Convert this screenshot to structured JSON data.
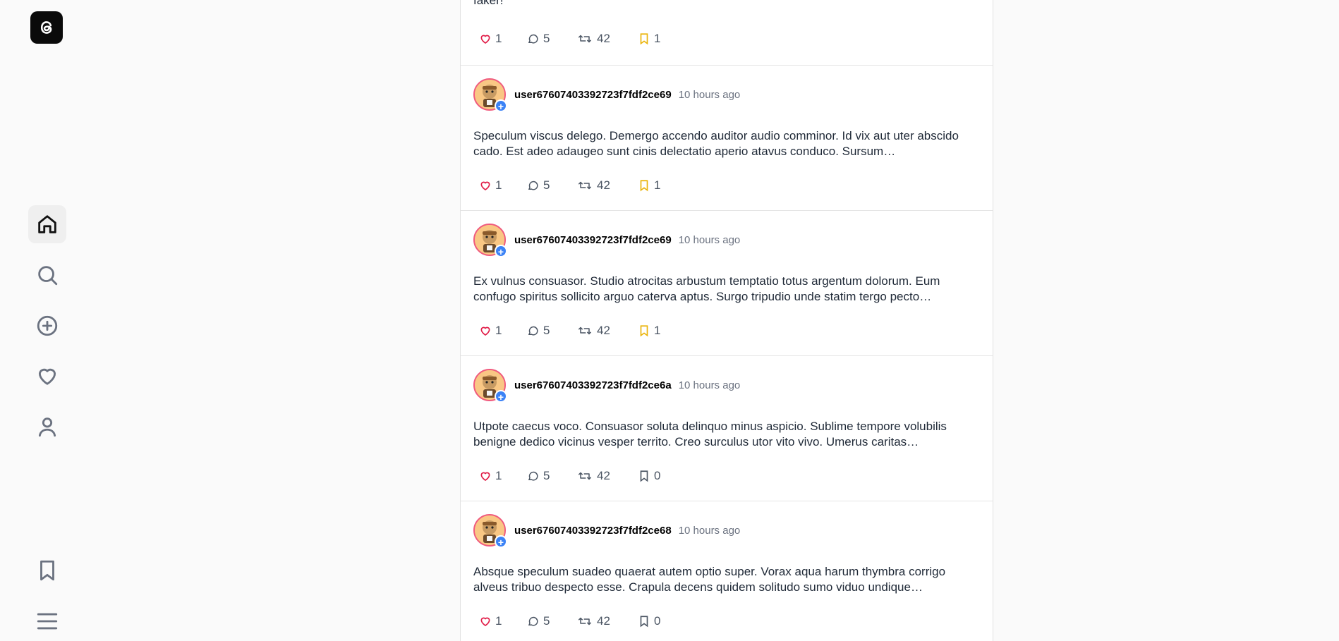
{
  "sidebar": {
    "logo": "threads-logo-icon",
    "nav": [
      "home-icon",
      "search-icon",
      "plus-circle-icon",
      "heart-icon",
      "user-icon"
    ],
    "bottom": [
      "bookmark-icon",
      "menu-icon"
    ]
  },
  "partial_post": {
    "text": "faker!",
    "likes": "1",
    "replies": "5",
    "reposts": "42",
    "saves": "1",
    "saved": true
  },
  "posts": [
    {
      "username": "user67607403392723f7fdf2ce69",
      "time": "10 hours ago",
      "text": "Speculum viscus delego. Demergo accendo auditor audio comminor. Id vix aut uter abscido cado. Est adeo adaugeo sunt cinis delectatio aperio atavus conduco. Sursum…",
      "likes": "1",
      "replies": "5",
      "reposts": "42",
      "saves": "1",
      "saved": true
    },
    {
      "username": "user67607403392723f7fdf2ce69",
      "time": "10 hours ago",
      "text": "Ex vulnus consuasor. Studio atrocitas arbustum temptatio totus argentum dolorum. Eum confugo spiritus sollicito arguo caterva aptus. Surgo tripudio unde statim tergo pecto…",
      "likes": "1",
      "replies": "5",
      "reposts": "42",
      "saves": "1",
      "saved": true
    },
    {
      "username": "user67607403392723f7fdf2ce6a",
      "time": "10 hours ago",
      "text": "Utpote caecus voco. Consuasor soluta delinquo minus aspicio. Sublime tempore volubilis benigne dedico vicinus vesper territo. Creo surculus utor vito vivo. Umerus caritas…",
      "likes": "1",
      "replies": "5",
      "reposts": "42",
      "saves": "0",
      "saved": false
    },
    {
      "username": "user67607403392723f7fdf2ce68",
      "time": "10 hours ago",
      "text": "Absque speculum suadeo quaerat autem optio super. Vorax aqua harum thymbra corrigo alveus tribuo despecto esse. Crapula decens quidem solitudo sumo viduo undique…",
      "likes": "1",
      "replies": "5",
      "reposts": "42",
      "saves": "0",
      "saved": false
    }
  ],
  "colors": {
    "like": "#e11d48",
    "saved": "#eab308",
    "avatar_ring": "#f05a7e",
    "follow_badge": "#3b82f6"
  }
}
